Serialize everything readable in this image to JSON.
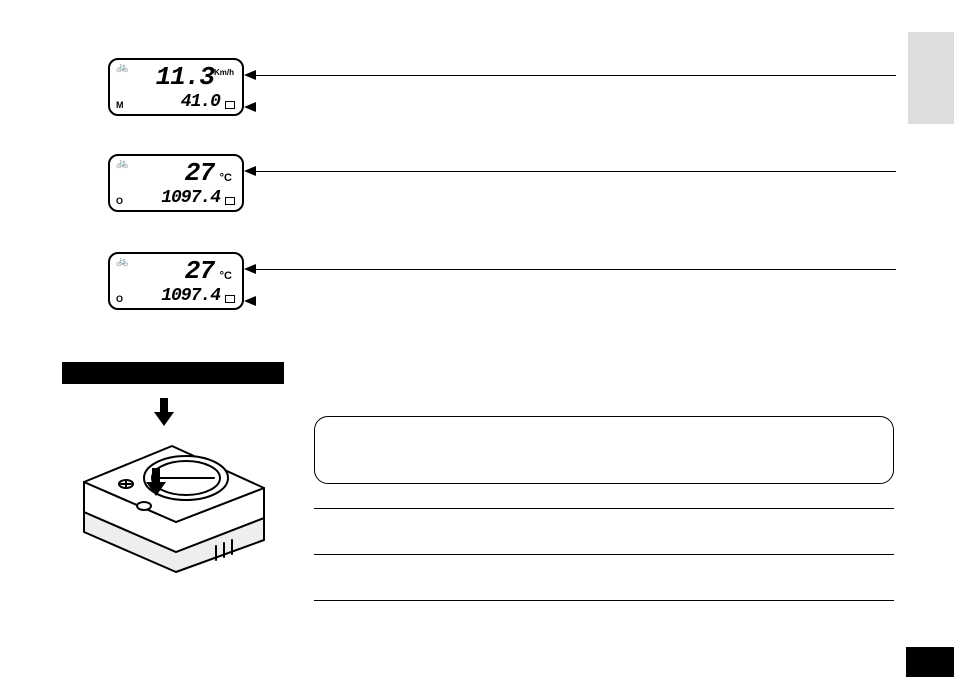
{
  "lcds": [
    {
      "bike_icon": "🚲",
      "mode": "M",
      "top_value": "11.3",
      "top_unit": "Km/h",
      "top_unit_big": false,
      "bottom_value": "41.0",
      "arrow_targets": [
        "top",
        "bottom"
      ]
    },
    {
      "bike_icon": "🚲",
      "mode": "O",
      "top_value": "27",
      "top_unit": "°C",
      "top_unit_big": true,
      "bottom_value": "1097.4",
      "arrow_targets": [
        "top"
      ]
    },
    {
      "bike_icon": "🚲",
      "mode": "O",
      "top_value": "27",
      "top_unit": "°C",
      "top_unit_big": true,
      "bottom_value": "1097.4",
      "arrow_targets": [
        "top",
        "bottom"
      ]
    }
  ],
  "device_arrows": [
    "down",
    "down"
  ]
}
